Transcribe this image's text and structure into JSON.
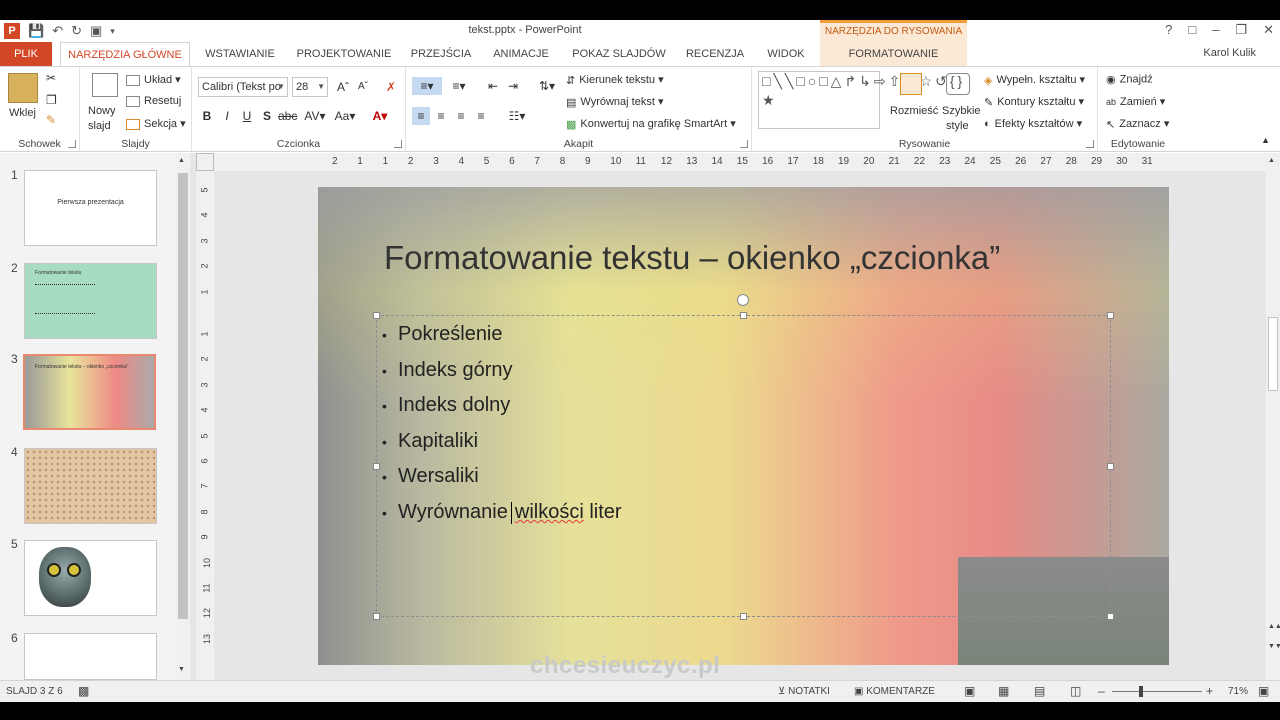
{
  "window": {
    "title": "tekst.pptx - PowerPoint",
    "context_tab_group": "NARZĘDZIA DO RYSOWANIA",
    "user": "Karol Kulik",
    "help": "?"
  },
  "tabs": [
    {
      "label": "PLIK"
    },
    {
      "label": "NARZĘDZIA GŁÓWNE"
    },
    {
      "label": "WSTAWIANIE"
    },
    {
      "label": "PROJEKTOWANIE"
    },
    {
      "label": "PRZEJŚCIA"
    },
    {
      "label": "ANIMACJE"
    },
    {
      "label": "POKAZ SLAJDÓW"
    },
    {
      "label": "RECENZJA"
    },
    {
      "label": "WIDOK"
    },
    {
      "label": "FORMATOWANIE"
    }
  ],
  "ribbon": {
    "clipboard": {
      "label": "Schowek",
      "paste": "Wklej"
    },
    "slides": {
      "label": "Slajdy",
      "new_slide_1": "Nowy",
      "new_slide_2": "slajd",
      "layout": "Układ",
      "reset": "Resetuj",
      "section": "Sekcja"
    },
    "font": {
      "label": "Czcionka",
      "font_name": "Calibri (Tekst po",
      "font_size": "28"
    },
    "paragraph": {
      "label": "Akapit",
      "direction": "Kierunek tekstu",
      "align": "Wyrównaj tekst",
      "smartart": "Konwertuj na grafikę SmartArt"
    },
    "drawing": {
      "label": "Rysowanie",
      "arrange": "Rozmieść",
      "quick_styles_1": "Szybkie",
      "quick_styles_2": "style",
      "fill": "Wypełn. kształtu",
      "outline": "Kontury kształtu",
      "effects": "Efekty kształtów"
    },
    "editing": {
      "label": "Edytowanie",
      "find": "Znajdź",
      "replace": "Zamień",
      "select": "Zaznacz"
    }
  },
  "thumbnails": [
    {
      "num": "1",
      "title": "Pierwsza prezentacja"
    },
    {
      "num": "2",
      "title": "Formatowanie tekstu"
    },
    {
      "num": "3",
      "title": "Formatowanie tekstu – okienko „czcionka”"
    },
    {
      "num": "4",
      "title": ""
    },
    {
      "num": "5",
      "title": ""
    },
    {
      "num": "6",
      "title": ""
    }
  ],
  "ruler_h": [
    "2",
    "1",
    "1",
    "2",
    "3",
    "4",
    "5",
    "6",
    "7",
    "8",
    "9",
    "10",
    "11",
    "12",
    "13",
    "14",
    "15",
    "16",
    "17",
    "18",
    "19",
    "20",
    "21",
    "22",
    "23",
    "24",
    "25",
    "26",
    "27",
    "28",
    "29",
    "30",
    "31"
  ],
  "ruler_v": [
    "5",
    "4",
    "3",
    "2",
    "1",
    "1",
    "2",
    "3",
    "4",
    "5",
    "6",
    "7",
    "8",
    "9",
    "10",
    "11",
    "12",
    "13"
  ],
  "slide": {
    "title": "Formatowanie tekstu – okienko „czcionka”",
    "bullets": [
      "Pokreślenie",
      "Indeks górny",
      "Indeks dolny",
      "Kapitaliki",
      "Wersaliki"
    ],
    "last_bullet_a": "Wyrównanie",
    "last_bullet_b": "wilkości",
    "last_bullet_c": "liter"
  },
  "status": {
    "slide": "SLAJD 3 Z 6",
    "notes": "NOTATKI",
    "comments": "KOMENTARZE",
    "zoom": "71%"
  },
  "watermark": "chcesieuczyc.pl"
}
